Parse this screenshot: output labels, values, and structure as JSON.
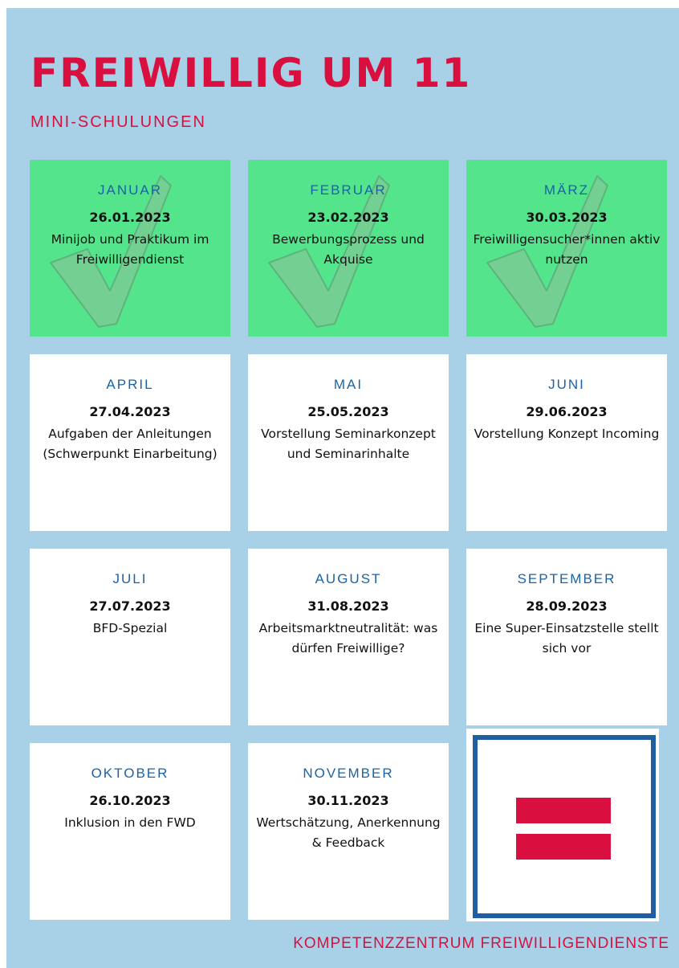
{
  "header": {
    "title": "FREIWILLIG UM 11",
    "subtitle": "MINI-SCHULUNGEN"
  },
  "colors": {
    "background": "#a8d0e6",
    "accent_red": "#d9103f",
    "month_blue": "#1b63a6",
    "done_green": "#54e58c"
  },
  "sessions": [
    {
      "month": "JANUAR",
      "date": "26.01.2023",
      "topic": "Minijob und Praktikum im Freiwilligendienst",
      "completed": true
    },
    {
      "month": "FEBRUAR",
      "date": "23.02.2023",
      "topic": "Bewerbungsprozess und Akquise",
      "completed": true
    },
    {
      "month": "MÄRZ",
      "date": "30.03.2023",
      "topic": "Freiwilligensucher*innen aktiv nutzen",
      "completed": true
    },
    {
      "month": "APRIL",
      "date": "27.04.2023",
      "topic": "Aufgaben der Anleitungen (Schwerpunkt Einarbeitung)",
      "completed": false
    },
    {
      "month": "MAI",
      "date": "25.05.2023",
      "topic": "Vorstellung Seminarkonzept und Seminarinhalte",
      "completed": false
    },
    {
      "month": "JUNI",
      "date": "29.06.2023",
      "topic": "Vorstellung Konzept Incoming",
      "completed": false
    },
    {
      "month": "JULI",
      "date": "27.07.2023",
      "topic": "BFD-Spezial",
      "completed": false
    },
    {
      "month": "AUGUST",
      "date": "31.08.2023",
      "topic": "Arbeitsmarktneutralität: was dürfen Freiwillige?",
      "completed": false
    },
    {
      "month": "SEPTEMBER",
      "date": "28.09.2023",
      "topic": "Eine Super-Einsatzstelle stellt sich vor",
      "completed": false
    },
    {
      "month": "OKTOBER",
      "date": "26.10.2023",
      "topic": "Inklusion in den FWD",
      "completed": false
    },
    {
      "month": "NOVEMBER",
      "date": "30.11.2023",
      "topic": "Wertschätzung, Anerkennung & Feedback",
      "completed": false
    }
  ],
  "logo": {
    "icon": "equals-logo"
  },
  "footer": {
    "text": "KOMPETENZZENTRUM FREIWILLIGENDIENSTE"
  }
}
